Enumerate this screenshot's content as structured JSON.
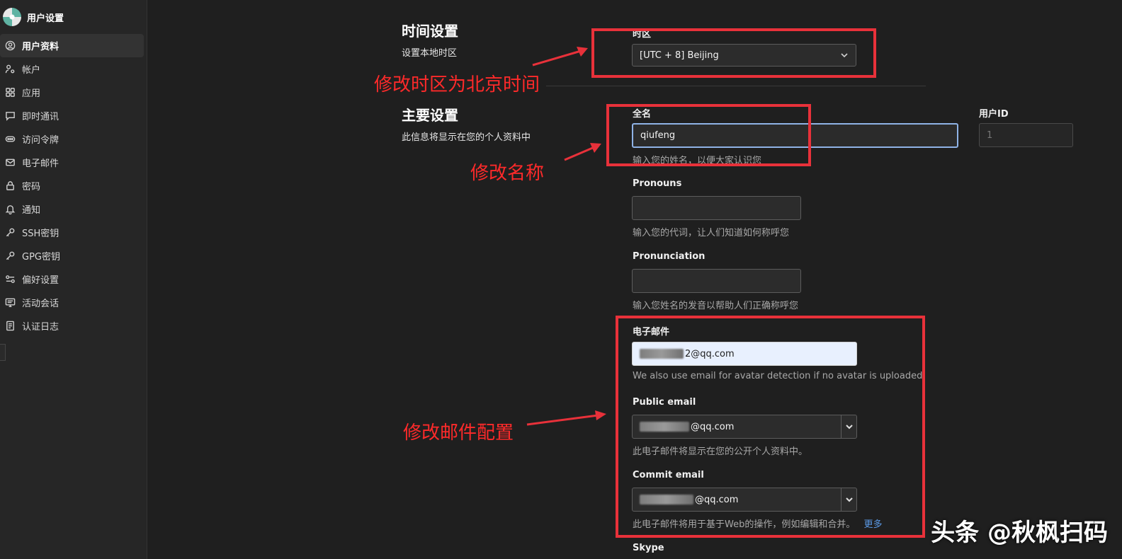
{
  "sidebar": {
    "title": "用户设置",
    "items": [
      {
        "label": "用户资料",
        "icon": "user-circle-icon",
        "active": true
      },
      {
        "label": "帐户",
        "icon": "user-gear-icon"
      },
      {
        "label": "应用",
        "icon": "apps-grid-icon"
      },
      {
        "label": "即时通讯",
        "icon": "chat-bubble-icon"
      },
      {
        "label": "访问令牌",
        "icon": "token-icon"
      },
      {
        "label": "电子邮件",
        "icon": "mail-icon"
      },
      {
        "label": "密码",
        "icon": "lock-icon"
      },
      {
        "label": "通知",
        "icon": "bell-icon"
      },
      {
        "label": "SSH密钥",
        "icon": "key-icon"
      },
      {
        "label": "GPG密钥",
        "icon": "key-icon"
      },
      {
        "label": "偏好设置",
        "icon": "preferences-icon"
      },
      {
        "label": "活动会话",
        "icon": "monitor-icon"
      },
      {
        "label": "认证日志",
        "icon": "log-icon"
      }
    ]
  },
  "time_section": {
    "title": "时间设置",
    "description": "设置本地时区",
    "timezone_label": "时区",
    "timezone_value": "[UTC + 8] Beijing"
  },
  "main_section": {
    "title": "主要设置",
    "description": "此信息将显示在您的个人资料中",
    "fullname_label": "全名",
    "fullname_value": "qiufeng",
    "fullname_help": "输入您的姓名，以便大家认识您",
    "userid_label": "用户ID",
    "userid_value": "1",
    "pronouns_label": "Pronouns",
    "pronouns_help": "输入您的代词，让人们知道如何称呼您",
    "pronunciation_label": "Pronunciation",
    "pronunciation_help": "输入您姓名的发音以帮助人们正确称呼您",
    "email_label": "电子邮件",
    "email_value": "2@qq.com",
    "email_help": "We also use email for avatar detection if no avatar is uploaded",
    "public_email_label": "Public email",
    "public_email_value": "@qq.com",
    "public_email_help": "此电子邮件将显示在您的公开个人资料中。",
    "commit_email_label": "Commit email",
    "commit_email_value": "@qq.com",
    "commit_email_help": "此电子邮件将用于基于Web的操作，例如编辑和合并。",
    "commit_email_more": "更多",
    "skype_label": "Skype"
  },
  "annotations": {
    "timezone_note": "修改时区为北京时间",
    "name_note": "修改名称",
    "email_note": "修改邮件配置"
  },
  "watermark": "头条 @秋枫扫码",
  "colors": {
    "annotation_red": "#e8313a",
    "link_blue": "#5b9be8"
  }
}
